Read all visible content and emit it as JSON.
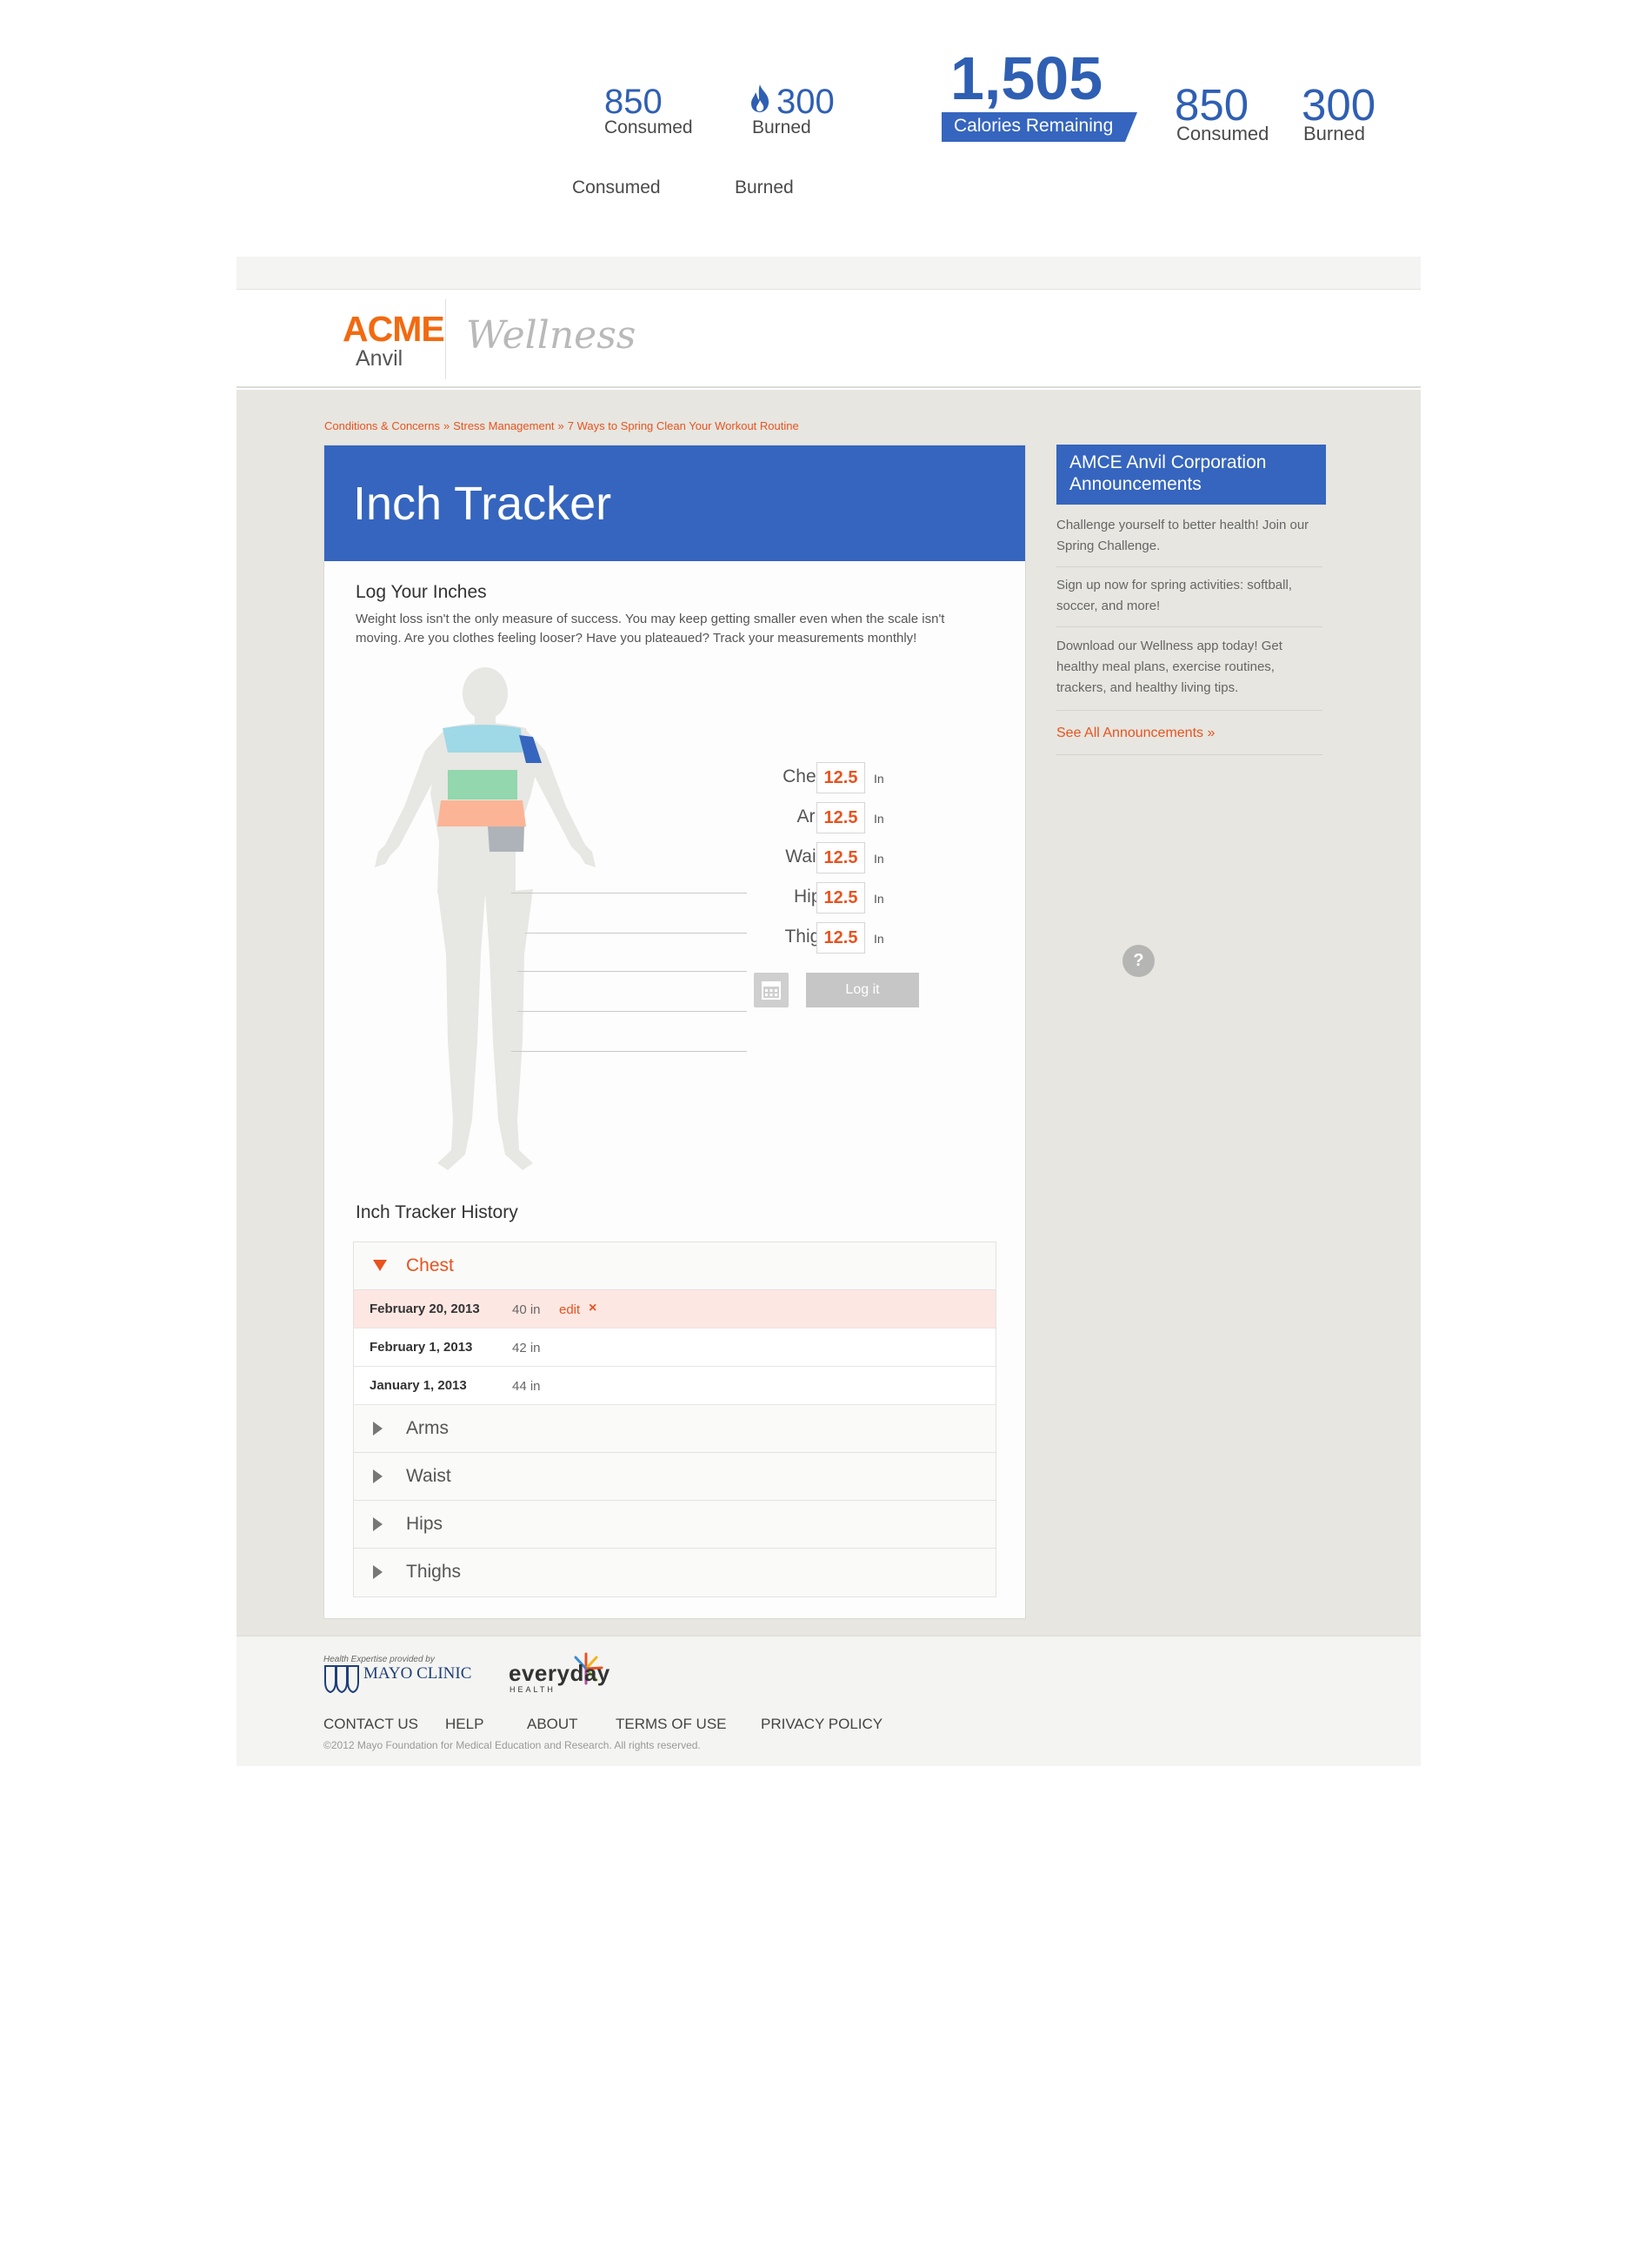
{
  "stats_small": {
    "consumed_value": "850",
    "consumed_label": "Consumed",
    "burned_value": "300",
    "burned_label": "Burned"
  },
  "stats_summary": {
    "remaining_value": "1,505",
    "remaining_label": "Calories Remaining",
    "consumed_value": "850",
    "consumed_label": "Consumed",
    "burned_value": "300",
    "burned_label": "Burned"
  },
  "stats_labels_only": {
    "consumed_label": "Consumed",
    "burned_label": "Burned"
  },
  "header": {
    "logo_primary": "ACME",
    "logo_secondary": "Anvil",
    "logo_product": "Wellness"
  },
  "breadcrumb": {
    "items": [
      "Conditions & Concerns",
      "Stress Management",
      "7 Ways to Spring Clean Your Workout Routine"
    ],
    "separator": "»"
  },
  "tracker": {
    "title": "Inch Tracker",
    "log_title": "Log Your Inches",
    "log_description": "Weight loss isn't the only measure of success. You may keep getting smaller even when the scale isn't moving. Are you clothes feeling looser? Have you plateaued? Track your measurements monthly!",
    "measurements": [
      {
        "label": "Chest",
        "value": "12.5",
        "unit": "In",
        "color": "#9fd8e6"
      },
      {
        "label": "Arm",
        "value": "12.5",
        "unit": "In",
        "color": "#3565be"
      },
      {
        "label": "Waist",
        "value": "12.5",
        "unit": "In",
        "color": "#92d7ad"
      },
      {
        "label": "Hips",
        "value": "12.5",
        "unit": "In",
        "color": "#fbb496"
      },
      {
        "label": "Thigh",
        "value": "12.5",
        "unit": "In",
        "color": "#aeb2b9"
      }
    ],
    "log_button": "Log it",
    "calendar_icon": "calendar-icon"
  },
  "history": {
    "title": "Inch Tracker History",
    "sections": [
      {
        "label": "Chest",
        "expanded": true,
        "entries": [
          {
            "date": "February 20, 2013",
            "value": "40 in",
            "edit": "edit",
            "delete": "×",
            "highlighted": true
          },
          {
            "date": "February 1, 2013",
            "value": "42 in"
          },
          {
            "date": "January 1, 2013",
            "value": "44 in"
          }
        ]
      },
      {
        "label": "Arms",
        "expanded": false
      },
      {
        "label": "Waist",
        "expanded": false
      },
      {
        "label": "Hips",
        "expanded": false
      },
      {
        "label": "Thighs",
        "expanded": false
      }
    ]
  },
  "sidebar": {
    "title": "AMCE Anvil Corporation Announcements",
    "announcements": [
      "Challenge yourself to better health! Join our Spring Challenge.",
      "Sign up now for spring activities: softball, soccer, and more!",
      "Download our Wellness app today! Get healthy meal plans, exercise routines, trackers, and healthy living tips."
    ],
    "see_all": "See All Announcements »",
    "help_glyph": "?"
  },
  "footer": {
    "mayo_tagline": "Health Expertise provided by",
    "mayo_name": "MAYO CLINIC",
    "partner_name": "everyday",
    "partner_sub": "HEALTH",
    "links": [
      "CONTACT US",
      "HELP",
      "ABOUT",
      "TERMS OF USE",
      "PRIVACY POLICY"
    ],
    "copyright": "©2012 Mayo Foundation for Medical Education and Research. All rights reserved."
  },
  "colors": {
    "brand_blue": "#3565be",
    "accent_orange": "#e8531f",
    "acme_orange": "#f26a10",
    "page_bg": "#e7e6e0"
  }
}
